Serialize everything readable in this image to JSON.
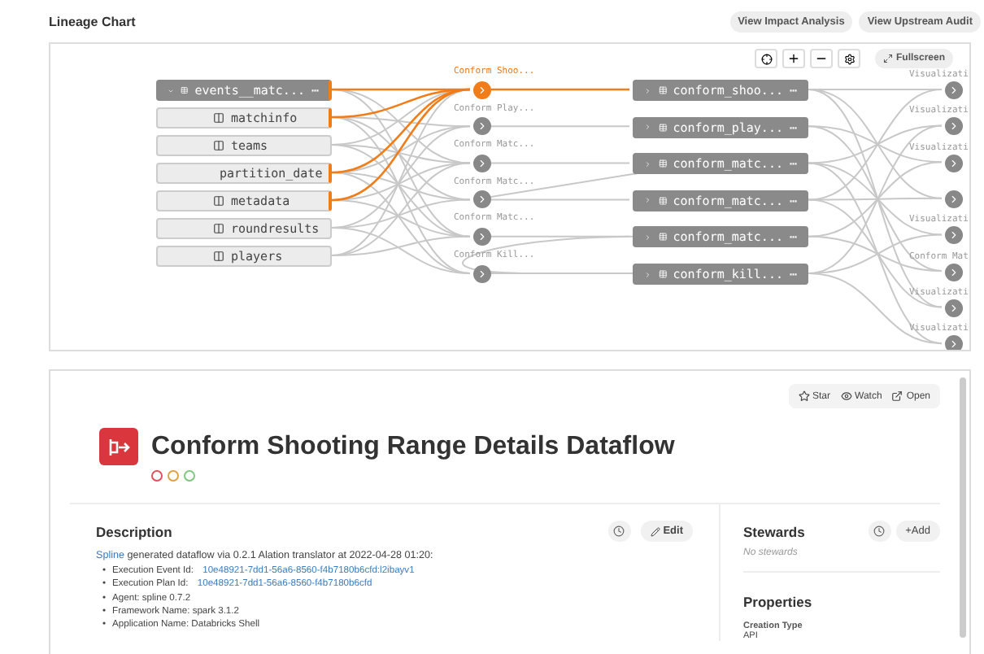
{
  "header": {
    "title": "Lineage Chart",
    "buttons": [
      "View Impact Analysis",
      "View Upstream Audit"
    ]
  },
  "graph": {
    "toolbar": {
      "fullscreen": "Fullscreen"
    },
    "sources": [
      {
        "kind": "table",
        "label": "events__matc...",
        "menu": "⋯",
        "highlighted": true
      },
      {
        "kind": "column",
        "label": "matchinfo",
        "highlighted": true
      },
      {
        "kind": "column",
        "label": "teams",
        "highlighted": false
      },
      {
        "kind": "column",
        "label": "partition_date",
        "highlighted": true
      },
      {
        "kind": "column",
        "label": "metadata",
        "highlighted": true
      },
      {
        "kind": "column",
        "label": "roundresults",
        "highlighted": false
      },
      {
        "kind": "column",
        "label": "players",
        "highlighted": false
      }
    ],
    "processes": [
      {
        "label": "Conform Shoo...",
        "highlighted": true
      },
      {
        "label": "Conform Play...",
        "highlighted": false
      },
      {
        "label": "Conform Matc...",
        "highlighted": false
      },
      {
        "label": "Conform Matc...",
        "highlighted": false
      },
      {
        "label": "Conform Matc...",
        "highlighted": false
      },
      {
        "label": "Conform Kill...",
        "highlighted": false
      }
    ],
    "outputs": [
      {
        "label": "conform_shoo...",
        "menu": "⋯"
      },
      {
        "label": "conform_play...",
        "menu": "⋯"
      },
      {
        "label": "conform_matc...",
        "menu": "⋯"
      },
      {
        "label": "conform_matc...",
        "menu": "⋯"
      },
      {
        "label": "conform_matc...",
        "menu": "⋯"
      },
      {
        "label": "conform_kill...",
        "menu": "⋯"
      }
    ],
    "downstream": [
      {
        "kind": "labeled",
        "label": "Visualizati"
      },
      {
        "kind": "labeled",
        "label": "Visualizati"
      },
      {
        "kind": "labeled",
        "label": "Visualizati"
      },
      {
        "kind": "plain"
      },
      {
        "kind": "labeled",
        "label": "Visualizati"
      },
      {
        "kind": "labeled",
        "label": "Conform Mat"
      },
      {
        "kind": "labeled",
        "label": "Visualizati"
      },
      {
        "kind": "labeled",
        "label": "Visualizati"
      }
    ]
  },
  "detail": {
    "actions": [
      "Star",
      "Watch",
      "Open"
    ],
    "title": "Conform Shooting Range Details Dataflow",
    "status_dots": [
      {
        "color": "#e0505a"
      },
      {
        "color": "#e0a040"
      },
      {
        "color": "#7cc87c"
      }
    ],
    "description": {
      "heading": "Description",
      "edit": "Edit",
      "bullet": "•",
      "intro_link": "Spline",
      "intro": " generated dataflow via 0.2.1 Alation translator at 2022-04-28 01:20:",
      "items": [
        {
          "label": "Execution Event Id: ",
          "link": "10e48921-7dd1-56a6-8560-f4b7180b6cfd:l2ibayv1"
        },
        {
          "label": "Execution Plan Id: ",
          "link": "10e48921-7dd1-56a6-8560-f4b7180b6cfd"
        },
        {
          "label": "Agent: spline 0.7.2"
        },
        {
          "label": "Framework Name: spark 3.1.2"
        },
        {
          "label": "Application Name: Databricks Shell"
        }
      ]
    },
    "stewards": {
      "heading": "Stewards",
      "add": "+Add",
      "empty": "No stewards"
    },
    "properties": {
      "heading": "Properties",
      "items": [
        {
          "name": "Creation Type",
          "value": "API"
        }
      ]
    }
  }
}
